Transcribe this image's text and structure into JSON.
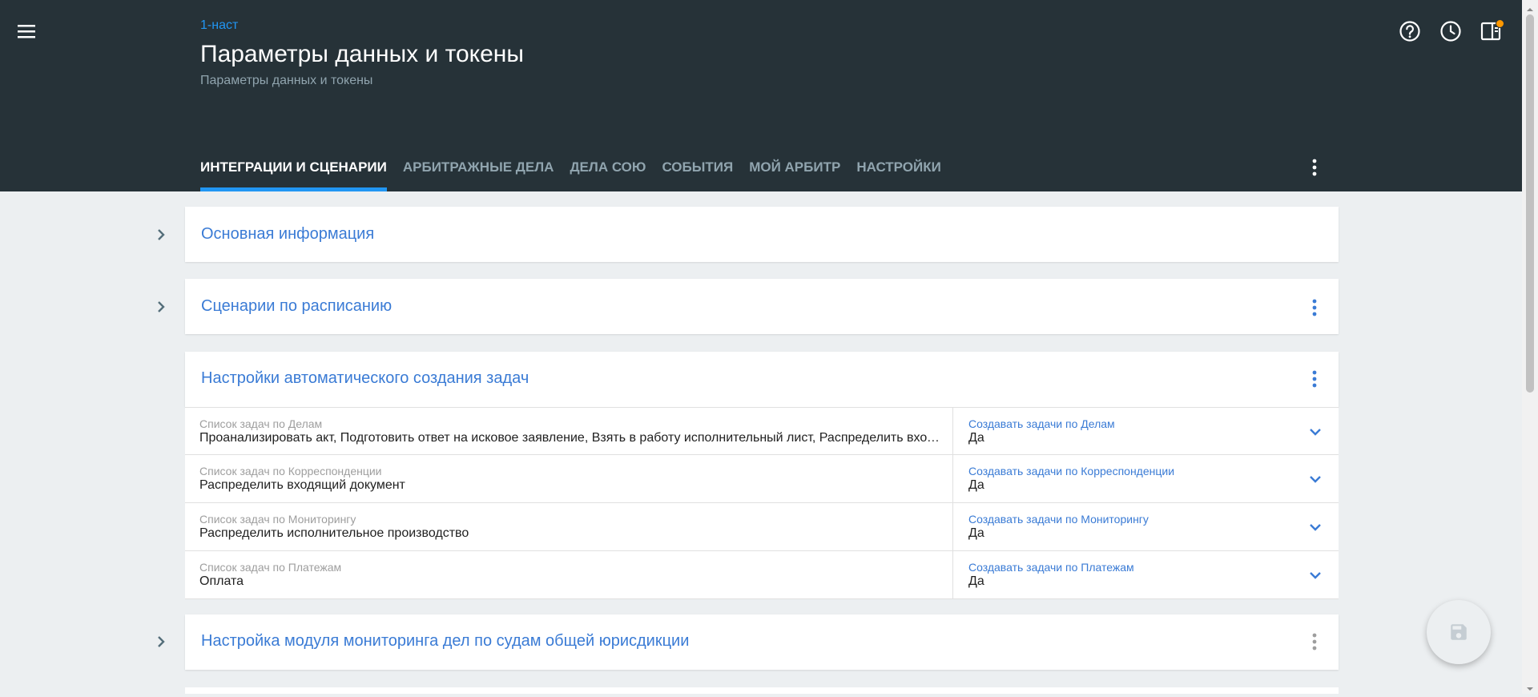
{
  "header": {
    "breadcrumb": "1-наст",
    "title": "Параметры данных и токены",
    "subtitle": "Параметры данных и токены",
    "icons": [
      "menu-icon",
      "help-icon",
      "history-icon",
      "panel-icon"
    ],
    "notification_color": "#ff9800"
  },
  "tabs": [
    {
      "label": "ИНТЕГРАЦИИ И СЦЕНАРИИ",
      "active": true
    },
    {
      "label": "АРБИТРАЖНЫЕ ДЕЛА",
      "active": false
    },
    {
      "label": "ДЕЛА СОЮ",
      "active": false
    },
    {
      "label": "СОБЫТИЯ",
      "active": false
    },
    {
      "label": "МОЙ АРБИТР",
      "active": false
    },
    {
      "label": "НАСТРОЙКИ",
      "active": false
    }
  ],
  "sections": [
    {
      "title": "Основная информация"
    },
    {
      "title": "Сценарии по расписанию"
    },
    {
      "title": "Настройки автоматического создания задач",
      "rows": [
        {
          "label": "Список задач по Делам",
          "value": "Проанализировать акт, Подготовить ответ на исковое заявление, Взять в работу исполнительный лист, Распределить входящий документ",
          "option_label": "Создавать задачи по Делам",
          "option_value": "Да"
        },
        {
          "label": "Список задач по Корреспонденции",
          "value": "Распределить входящий документ",
          "option_label": "Создавать задачи по Корреспонденции",
          "option_value": "Да"
        },
        {
          "label": "Список задач по Мониторингу",
          "value": "Распределить исполнительное производство",
          "option_label": "Создавать задачи по Мониторингу",
          "option_value": "Да"
        },
        {
          "label": "Список задач по Платежам",
          "value": "Оплата",
          "option_label": "Создавать задачи по Платежам",
          "option_value": "Да"
        }
      ]
    },
    {
      "title": "Настройка модуля мониторинга дел по судам общей юрисдикции"
    }
  ],
  "colors": {
    "header_bg": "#263238",
    "accent": "#2196f3",
    "link": "#3a7bd5",
    "page_bg": "#eceff1"
  }
}
